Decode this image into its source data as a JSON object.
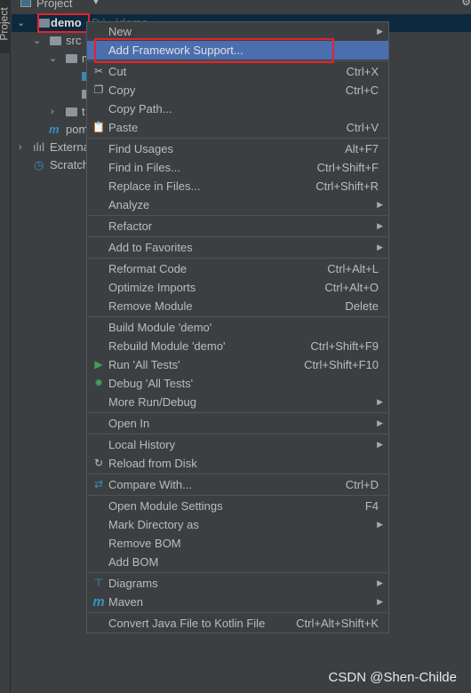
{
  "tool_window": {
    "tab": "Project",
    "title": "Project",
    "dropdown_icon": "caret-down-icon"
  },
  "tree": {
    "root": "demo",
    "root_path": "D:\\...\\demo",
    "items": [
      "src",
      "m",
      "t",
      "pom",
      "External Libraries",
      "Scratches"
    ],
    "src": "src",
    "main": "m",
    "test": "t",
    "pom": "pom",
    "external": "Externa",
    "scratches": "Scratch"
  },
  "menu": {
    "new": "New",
    "add_framework": "Add Framework Support...",
    "cut": "Cut",
    "cut_sc": "Ctrl+X",
    "copy": "Copy",
    "copy_sc": "Ctrl+C",
    "copy_path": "Copy Path...",
    "paste": "Paste",
    "paste_sc": "Ctrl+V",
    "find_usages": "Find Usages",
    "find_usages_sc": "Alt+F7",
    "find_files": "Find in Files...",
    "find_files_sc": "Ctrl+Shift+F",
    "replace_files": "Replace in Files...",
    "replace_files_sc": "Ctrl+Shift+R",
    "analyze": "Analyze",
    "refactor": "Refactor",
    "favorites": "Add to Favorites",
    "reformat": "Reformat Code",
    "reformat_sc": "Ctrl+Alt+L",
    "optimize": "Optimize Imports",
    "optimize_sc": "Ctrl+Alt+O",
    "remove_module": "Remove Module",
    "remove_module_sc": "Delete",
    "build": "Build Module 'demo'",
    "rebuild": "Rebuild Module 'demo'",
    "rebuild_sc": "Ctrl+Shift+F9",
    "run": "Run 'All Tests'",
    "run_sc": "Ctrl+Shift+F10",
    "debug": "Debug 'All Tests'",
    "more_run": "More Run/Debug",
    "open_in": "Open In",
    "local_history": "Local History",
    "reload": "Reload from Disk",
    "compare": "Compare With...",
    "compare_sc": "Ctrl+D",
    "module_settings": "Open Module Settings",
    "module_settings_sc": "F4",
    "mark_dir": "Mark Directory as",
    "remove_bom": "Remove BOM",
    "add_bom": "Add BOM",
    "diagrams": "Diagrams",
    "maven": "Maven",
    "convert": "Convert Java File to Kotlin File",
    "convert_sc": "Ctrl+Alt+Shift+K"
  },
  "colors": {
    "selection": "#4b6eaf",
    "highlight_box": "#e8202a",
    "tree_selection": "#0d293e",
    "run_green": "#499c54",
    "accent_blue": "#3592c4"
  },
  "watermark": "CSDN @Shen-Childe"
}
